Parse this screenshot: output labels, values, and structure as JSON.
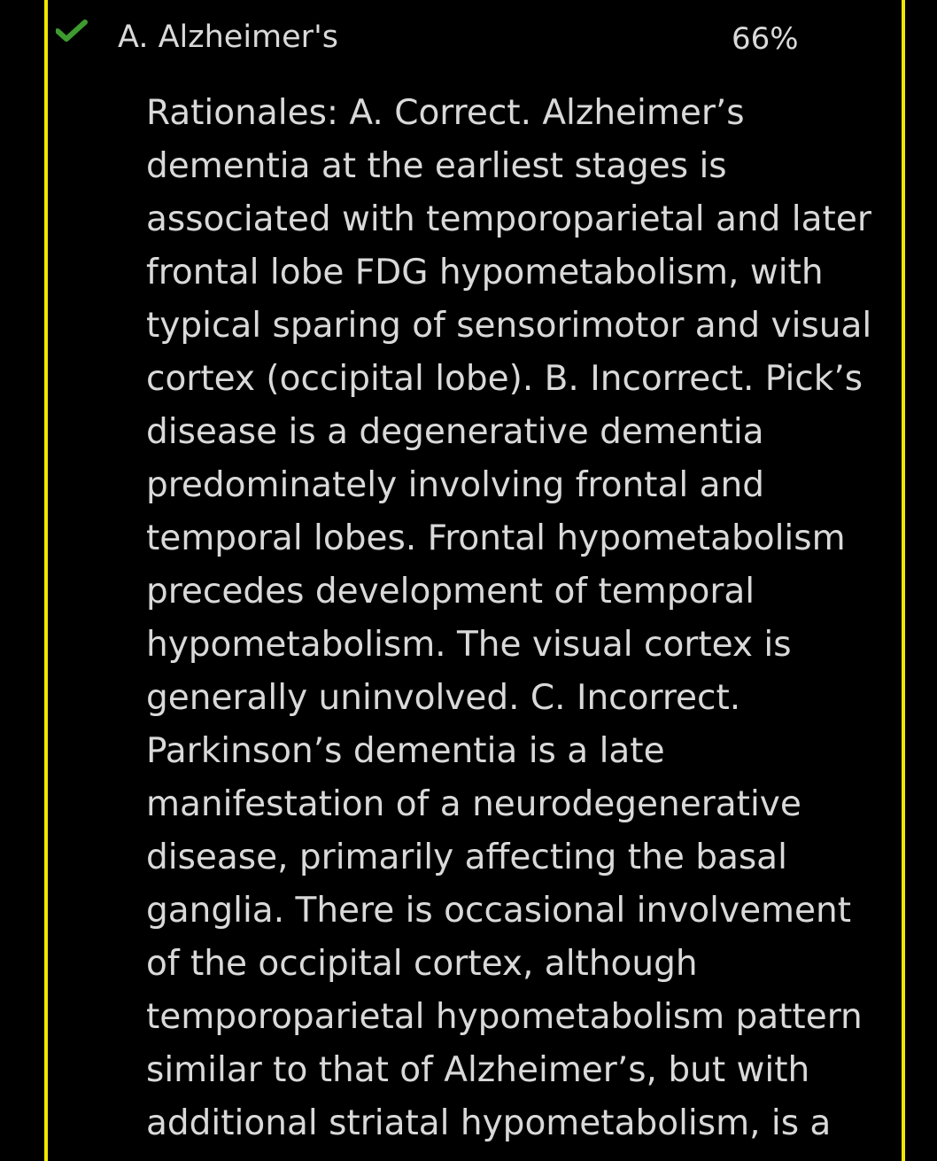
{
  "answer": {
    "label": "A. Alzheimer's",
    "percent": "66%",
    "status_icon": "check-icon",
    "status_color": "#3e9b2f"
  },
  "accent_color": "#f2e600",
  "rationale": {
    "lines": [
      "Rationales: A. Correct. Alzheimer’s",
      "dementia at the earliest stages is",
      "associated with temporoparietal and later",
      "frontal lobe FDG hypometabolism, with",
      "typical sparing of sensorimotor and visual",
      "cortex (occipital lobe). B. Incorrect. Pick’s",
      "disease is a degenerative dementia",
      "predominately involving frontal and",
      "temporal lobes. Frontal hypometabolism",
      "precedes development of temporal",
      "hypometabolism. The visual cortex is",
      "generally uninvolved. C. Incorrect.",
      "Parkinson’s dementia is a late",
      "manifestation of a neurodegenerative",
      "disease, primarily affecting the basal",
      "ganglia. There is occasional involvement",
      "of the occipital cortex, although",
      "temporoparietal hypometabolism pattern",
      "similar to that of Alzheimer’s, but with",
      "additional striatal hypometabolism, is a"
    ]
  }
}
